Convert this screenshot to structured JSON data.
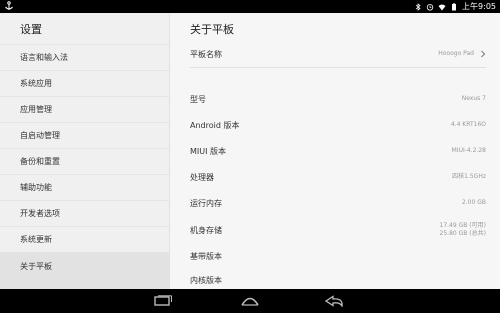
{
  "status_bar": {
    "left_icon": "anchor-icon",
    "icons": [
      "bluetooth-icon",
      "alarm-icon",
      "wifi-icon",
      "battery-icon"
    ],
    "time": "上午9:05"
  },
  "sidebar": {
    "title": "设置",
    "items": [
      {
        "label": "语言和输入法"
      },
      {
        "label": "系统应用"
      },
      {
        "label": "应用管理"
      },
      {
        "label": "自启动管理"
      },
      {
        "label": "备份和重置"
      },
      {
        "label": "辅助功能"
      },
      {
        "label": "开发者选项"
      },
      {
        "label": "系统更新"
      },
      {
        "label": "关于平板"
      }
    ],
    "active_index": 8
  },
  "content": {
    "title": "关于平板",
    "rows": [
      {
        "label": "平板名称",
        "value": "Hooogo Pad"
      },
      {
        "label": "型号",
        "value": "Nexus 7"
      },
      {
        "label": "Android 版本",
        "value": "4.4 KRT16O"
      },
      {
        "label": "MIUI 版本",
        "value": "MIUI-4.2.28"
      },
      {
        "label": "处理器",
        "value": "四核1.5GHz"
      },
      {
        "label": "运行内存",
        "value": "2.00 GB"
      },
      {
        "label": "机身存储",
        "value_line1": "17.49 GB (可用)",
        "value_line2": "25.80 GB (总共)"
      },
      {
        "label": "基带版本"
      },
      {
        "label": "内核版本"
      }
    ]
  },
  "nav_bar": {
    "buttons": [
      "recent-apps-icon",
      "home-icon",
      "back-icon"
    ]
  }
}
